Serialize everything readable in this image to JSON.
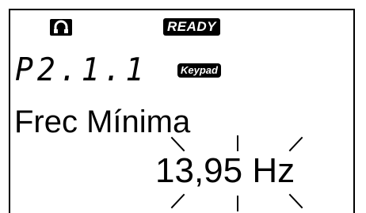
{
  "status": {
    "control_place_icon": "keypad-control-icon",
    "ready_label": "READY"
  },
  "parameter": {
    "code": "P2.1.1",
    "source_label": "Keypad",
    "name": "Frec Mínima",
    "value": "13,95 Hz",
    "editing_indicator": "blinking-value"
  },
  "colors": {
    "background": "#ffffff",
    "foreground": "#000000"
  }
}
